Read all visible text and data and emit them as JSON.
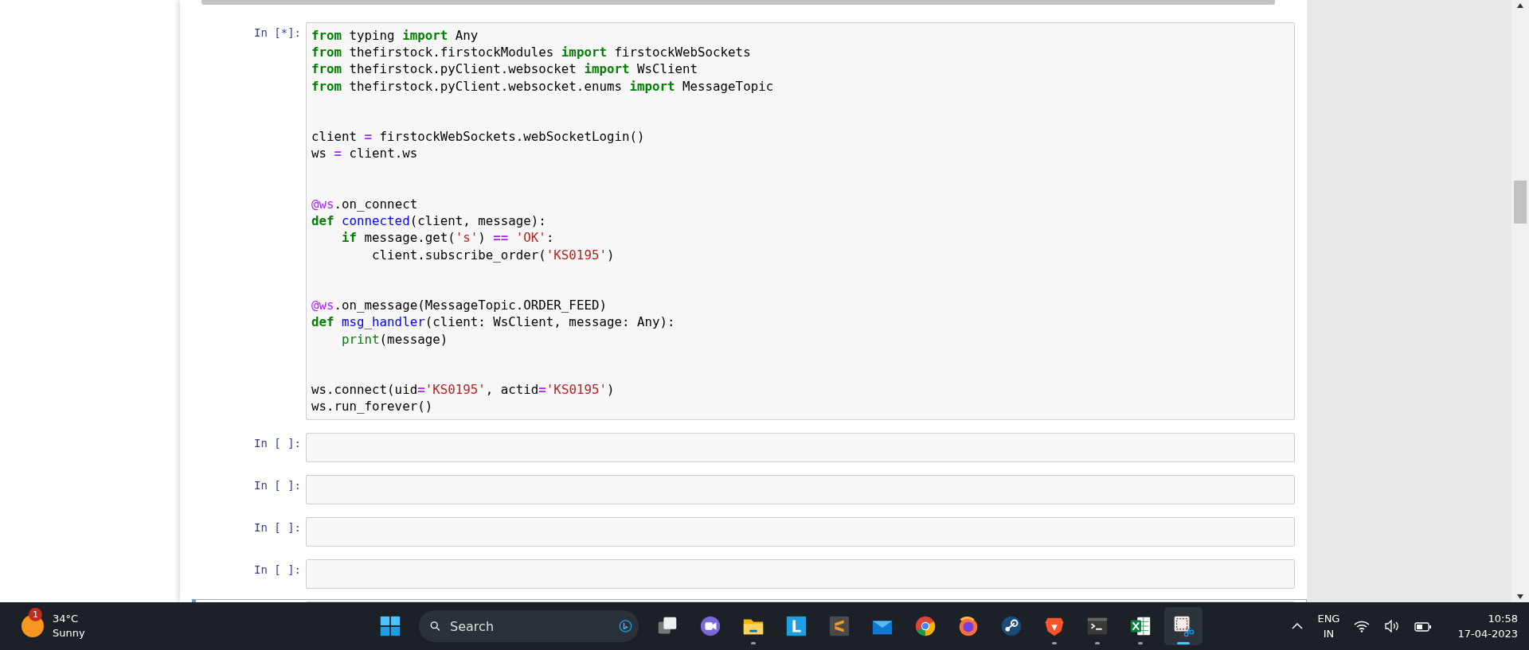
{
  "notebook": {
    "cells": [
      {
        "prompt": "In [*]:",
        "selected": false,
        "blocks": [
          [
            [
              {
                "text": "from",
                "kind": "kw"
              },
              {
                "text": " typing ",
                "kind": "p"
              },
              {
                "text": "import",
                "kind": "kw"
              },
              {
                "text": " Any",
                "kind": "p"
              }
            ],
            [
              {
                "text": "from",
                "kind": "kw"
              },
              {
                "text": " thefirstock.firstockModules ",
                "kind": "p"
              },
              {
                "text": "import",
                "kind": "kw"
              },
              {
                "text": " firstockWebSockets",
                "kind": "p"
              }
            ],
            [
              {
                "text": "from",
                "kind": "kw"
              },
              {
                "text": " thefirstock.pyClient.websocket ",
                "kind": "p"
              },
              {
                "text": "import",
                "kind": "kw"
              },
              {
                "text": " WsClient",
                "kind": "p"
              }
            ],
            [
              {
                "text": "from",
                "kind": "kw"
              },
              {
                "text": " thefirstock.pyClient.websocket.enums ",
                "kind": "p"
              },
              {
                "text": "import",
                "kind": "kw"
              },
              {
                "text": " MessageTopic",
                "kind": "p"
              }
            ]
          ],
          [
            [
              {
                "text": "client ",
                "kind": "p"
              },
              {
                "text": "=",
                "kind": "op"
              },
              {
                "text": " firstockWebSockets.webSocketLogin()",
                "kind": "p"
              }
            ],
            [
              {
                "text": "ws ",
                "kind": "p"
              },
              {
                "text": "=",
                "kind": "op"
              },
              {
                "text": " client.ws",
                "kind": "p"
              }
            ]
          ],
          [
            [
              {
                "text": "@ws",
                "kind": "deco"
              },
              {
                "text": ".on_connect",
                "kind": "p"
              }
            ],
            [
              {
                "text": "def ",
                "kind": "kw"
              },
              {
                "text": "connected",
                "kind": "fn"
              },
              {
                "text": "(client, message):",
                "kind": "p"
              }
            ],
            [
              {
                "text": "    if",
                "kind": "kw"
              },
              {
                "text": " message.get(",
                "kind": "p"
              },
              {
                "text": "'s'",
                "kind": "str"
              },
              {
                "text": ") ",
                "kind": "p"
              },
              {
                "text": "==",
                "kind": "op"
              },
              {
                "text": " 'OK'",
                "kind": "str"
              },
              {
                "text": ":",
                "kind": "p"
              }
            ],
            [
              {
                "text": "        client.subscribe_order(",
                "kind": "p"
              },
              {
                "text": "'KS0195'",
                "kind": "str"
              },
              {
                "text": ")",
                "kind": "p"
              }
            ]
          ],
          [
            [
              {
                "text": "@ws",
                "kind": "deco"
              },
              {
                "text": ".on_message(MessageTopic.ORDER_FEED)",
                "kind": "p"
              }
            ],
            [
              {
                "text": "def ",
                "kind": "kw"
              },
              {
                "text": "msg_handler",
                "kind": "fn"
              },
              {
                "text": "(client: WsClient, message: Any):",
                "kind": "p"
              }
            ],
            [
              {
                "text": "    print",
                "kind": "builtin"
              },
              {
                "text": "(message)",
                "kind": "p"
              }
            ]
          ],
          [
            [
              {
                "text": "ws.connect(uid",
                "kind": "p"
              },
              {
                "text": "=",
                "kind": "op"
              },
              {
                "text": "'KS0195'",
                "kind": "str"
              },
              {
                "text": ", actid",
                "kind": "p"
              },
              {
                "text": "=",
                "kind": "op"
              },
              {
                "text": "'KS0195'",
                "kind": "str"
              },
              {
                "text": ")",
                "kind": "p"
              }
            ],
            [
              {
                "text": "ws.run_forever()",
                "kind": "p"
              }
            ]
          ]
        ]
      },
      {
        "prompt": "In [ ]:",
        "selected": false
      },
      {
        "prompt": "In [ ]:",
        "selected": false
      },
      {
        "prompt": "In [ ]:",
        "selected": false
      },
      {
        "prompt": "In [ ]:",
        "selected": false
      },
      {
        "selected": true
      }
    ]
  },
  "taskbar": {
    "weather": {
      "badge": "1",
      "temperature": "34°C",
      "condition": "Sunny"
    },
    "search": {
      "placeholder": "Search"
    },
    "apps": [
      {
        "kind": "start",
        "running": false,
        "selected": false
      },
      {
        "kind": "taskview",
        "running": false,
        "selected": false
      },
      {
        "kind": "chat",
        "running": false,
        "selected": false
      },
      {
        "kind": "explorer",
        "running": true,
        "selected": false
      },
      {
        "kind": "letter",
        "running": false,
        "selected": false
      },
      {
        "kind": "sublime",
        "running": false,
        "selected": false
      },
      {
        "kind": "mail",
        "running": false,
        "selected": false
      },
      {
        "kind": "chrome",
        "running": false,
        "selected": false
      },
      {
        "kind": "firefox",
        "running": false,
        "selected": false
      },
      {
        "kind": "steam",
        "running": false,
        "selected": false
      },
      {
        "kind": "brave",
        "running": true,
        "selected": false
      },
      {
        "kind": "terminal",
        "running": true,
        "selected": false
      },
      {
        "kind": "excel",
        "running": true,
        "selected": false
      },
      {
        "kind": "snip",
        "running": true,
        "selected": true
      }
    ],
    "language": {
      "line1": "ENG",
      "line2": "IN"
    },
    "clock": {
      "time": "10:58",
      "date": "17-04-2023"
    }
  }
}
